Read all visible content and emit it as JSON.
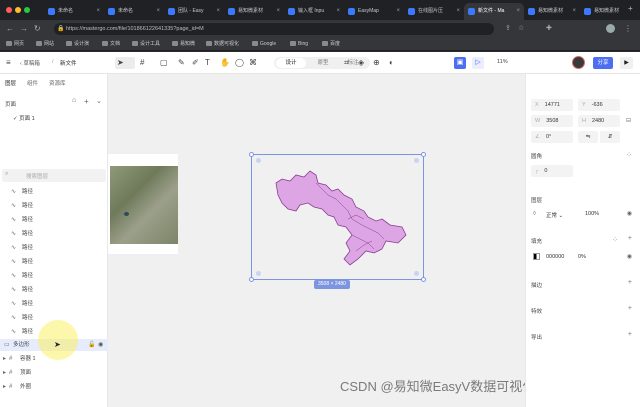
{
  "browser": {
    "tabs": [
      {
        "label": "未命名"
      },
      {
        "label": "未命名"
      },
      {
        "label": "团队 - Easy"
      },
      {
        "label": "易知微素材"
      },
      {
        "label": "输入框 Inpu"
      },
      {
        "label": "EasyMap"
      },
      {
        "label": "在线图片压"
      },
      {
        "label": "新文件 - Ma"
      },
      {
        "label": "易知微素材"
      },
      {
        "label": "易知微素材"
      }
    ],
    "url": "https://mastergo.com/file/101866122641335?page_id=M",
    "bookmarks": [
      "网页",
      "网站",
      "设计演",
      "文档",
      "设计工具",
      "易知微",
      "数据可视化",
      "Google",
      "Bing",
      "百度"
    ]
  },
  "app": {
    "back_label": "草稿箱",
    "file_name": "新文件",
    "mode_tabs": [
      "设计",
      "原型",
      "标注"
    ],
    "zoom": "11%",
    "share_label": "分享"
  },
  "left_panel": {
    "tabs": [
      "图层",
      "组件",
      "资源库"
    ],
    "pages_label": "页面",
    "page_item": "页面 1",
    "search_placeholder": "搜索图层",
    "layers": [
      "路径",
      "路径",
      "路径",
      "路径",
      "路径",
      "路径",
      "路径",
      "路径",
      "路径",
      "路径",
      "路径"
    ],
    "selected_layer": "多边形",
    "groups": [
      "容器 1",
      "顶面",
      "外圈"
    ]
  },
  "canvas": {
    "selection_size": "3508 × 2480"
  },
  "right_panel": {
    "x_label": "X",
    "x_value": "14771",
    "y_label": "Y",
    "y_value": "-636",
    "w_label": "W",
    "w_value": "3508",
    "h_label": "H",
    "h_value": "2480",
    "rotation": "0°",
    "corner_section": "圆角",
    "corner_value": "0",
    "layer_section": "图层",
    "blend_mode": "正常",
    "opacity": "100%",
    "fill_section": "填充",
    "fill_hex": "000000",
    "fill_opacity": "0%",
    "stroke_section": "描边",
    "effect_section": "特效",
    "export_section": "导出"
  },
  "watermark": "CSDN @易知微EasyV数据可视化",
  "colors": {
    "accent": "#4e6ef2",
    "region_fill": "#dda5e3",
    "region_stroke": "#8a3c96",
    "selection": "#7d95e0"
  }
}
